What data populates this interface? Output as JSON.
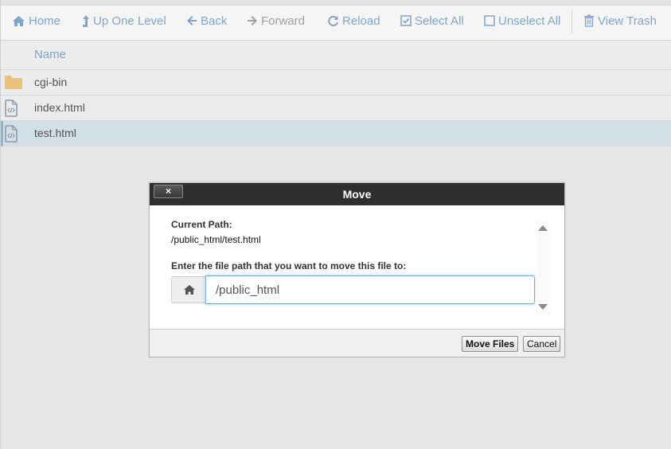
{
  "toolbar": {
    "home": "Home",
    "up_one_level": "Up One Level",
    "back": "Back",
    "forward": "Forward",
    "reload": "Reload",
    "select_all": "Select All",
    "unselect_all": "Unselect All",
    "view_trash": "View Trash"
  },
  "table": {
    "column_name": "Name",
    "rows": [
      {
        "name": "cgi-bin",
        "icon": "folder-icon",
        "selected": false
      },
      {
        "name": "index.html",
        "icon": "html-file-icon",
        "selected": false
      },
      {
        "name": "test.html",
        "icon": "html-file-icon",
        "selected": true
      }
    ]
  },
  "dialog": {
    "title": "Move",
    "close_label": "×",
    "current_path_label": "Current Path:",
    "current_path_value": "/public_html/test.html",
    "prompt": "Enter the file path that you want to move this file to:",
    "path_value": "/public_html",
    "move_button": "Move Files",
    "cancel_button": "Cancel"
  },
  "colors": {
    "link": "#7fa6cc",
    "selected_row": "#d3dfe7",
    "dialog_header": "#2e2e2e",
    "folder": "#e8c27a"
  }
}
